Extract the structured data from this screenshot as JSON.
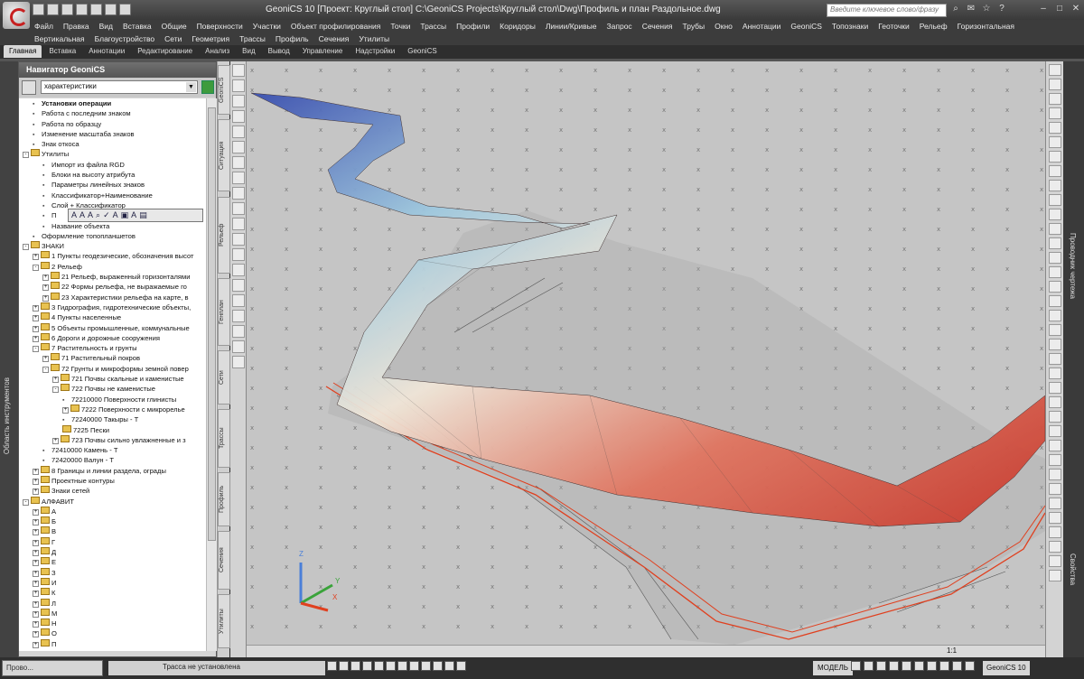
{
  "titlebar": {
    "title": "GeoniCS 10 [Проект: Круглый стол]   C:\\GeoniCS Projects\\Круглый стол\\Dwg\\Профиль и план Раздольное.dwg",
    "search_placeholder": "Введите ключевое слово/фразу"
  },
  "menu": {
    "row1": [
      "Файл",
      "Правка",
      "Вид",
      "Вставка",
      "Общие",
      "Поверхности",
      "Участки",
      "Объект профилирования",
      "Точки",
      "Трассы",
      "Профили",
      "Коридоры",
      "Линии/Кривые",
      "Запрос",
      "Сечения",
      "Трубы",
      "Окно",
      "Аннотации",
      "GeoniCS",
      "Топознаки",
      "Геоточки",
      "Рельеф",
      "Горизонтальная"
    ],
    "row2": [
      "Вертикальная",
      "Благоустройство",
      "Сети",
      "Геометрия",
      "Трассы",
      "Профиль",
      "Сечения",
      "Утилиты"
    ]
  },
  "ribbon_tabs": [
    "Главная",
    "Вставка",
    "Аннотации",
    "Редактирование",
    "Анализ",
    "Вид",
    "Вывод",
    "Управление",
    "Надстройки",
    "GeoniCS"
  ],
  "left_strip_label": "Область инструментов",
  "navigator": {
    "title": "Навигатор GeoniCS",
    "filter_value": "характеристики",
    "rows": [
      {
        "t": "Установки операции",
        "lvl": 1,
        "bold": true
      },
      {
        "t": "Работа с последним знаком",
        "lvl": 1
      },
      {
        "t": "Работа по образцу",
        "lvl": 1
      },
      {
        "t": "Изменение масштаба знаков",
        "lvl": 1
      },
      {
        "t": "Знак откоса",
        "lvl": 1
      },
      {
        "t": "Утилиты",
        "lvl": 0,
        "f": true,
        "pm": "−"
      },
      {
        "t": "Импорт из файла RGD",
        "lvl": 2
      },
      {
        "t": "Блоки на высоту атрибута",
        "lvl": 2
      },
      {
        "t": "Параметры линейных знаков",
        "lvl": 2
      },
      {
        "t": "Классификатор+Наименование",
        "lvl": 2
      },
      {
        "t": "Слой + Классификатор",
        "lvl": 2
      },
      {
        "t": "П",
        "lvl": 2
      },
      {
        "t": "Название объекта",
        "lvl": 2
      },
      {
        "t": "Оформление топопланшетов",
        "lvl": 1
      },
      {
        "t": "ЗНАКИ",
        "lvl": 0,
        "f": true,
        "pm": "−"
      },
      {
        "t": "1 Пункты геодезические, обозначения высот",
        "lvl": 1,
        "f": true,
        "pm": "+"
      },
      {
        "t": "2 Рельеф",
        "lvl": 1,
        "f": true,
        "pm": "−"
      },
      {
        "t": "21 Рельеф, выраженный горизонталями",
        "lvl": 2,
        "f": true,
        "pm": "+"
      },
      {
        "t": "22 Формы рельефа, не выражаемые го",
        "lvl": 2,
        "f": true,
        "pm": "+"
      },
      {
        "t": "23 Характеристики рельефа на карте, в",
        "lvl": 2,
        "f": true,
        "pm": "+"
      },
      {
        "t": "3 Гидрография, гидротехнические объекты,",
        "lvl": 1,
        "f": true,
        "pm": "+"
      },
      {
        "t": "4 Пункты населенные",
        "lvl": 1,
        "f": true,
        "pm": "+"
      },
      {
        "t": "5 Объекты промышленные, коммунальные",
        "lvl": 1,
        "f": true,
        "pm": "+"
      },
      {
        "t": "6 Дороги и дорожные сооружения",
        "lvl": 1,
        "f": true,
        "pm": "+"
      },
      {
        "t": "7 Растительность и грунты",
        "lvl": 1,
        "f": true,
        "pm": "−"
      },
      {
        "t": "71 Растительный покров",
        "lvl": 2,
        "f": true,
        "pm": "+"
      },
      {
        "t": "72 Грунты и микроформы земной повер",
        "lvl": 2,
        "f": true,
        "pm": "−"
      },
      {
        "t": "721 Почвы скальные и каменистые",
        "lvl": 3,
        "f": true,
        "pm": "+"
      },
      {
        "t": "722 Почвы не каменистые",
        "lvl": 3,
        "f": true,
        "pm": "−"
      },
      {
        "t": "72210000 Поверхности глинисты",
        "lvl": 4
      },
      {
        "t": "7222 Поверхности с микрорелье",
        "lvl": 4,
        "f": true,
        "pm": "+"
      },
      {
        "t": "72240000 Такыры - Т",
        "lvl": 4
      },
      {
        "t": "7225 Пески",
        "lvl": 4,
        "f": true
      },
      {
        "t": "723 Почвы сильно увлажненные и з",
        "lvl": 3,
        "f": true,
        "pm": "+"
      },
      {
        "t": "72410000 Камень - Т",
        "lvl": 2
      },
      {
        "t": "72420000 Валун - Т",
        "lvl": 2
      },
      {
        "t": "8 Границы и линии раздела, ограды",
        "lvl": 1,
        "f": true,
        "pm": "+"
      },
      {
        "t": "Проектные контуры",
        "lvl": 1,
        "f": true,
        "pm": "+"
      },
      {
        "t": "Знаки сетей",
        "lvl": 1,
        "f": true,
        "pm": "+"
      },
      {
        "t": "АЛФАВИТ",
        "lvl": 0,
        "f": true,
        "pm": "−"
      },
      {
        "t": "А",
        "lvl": 1,
        "f": true,
        "pm": "+"
      },
      {
        "t": "Б",
        "lvl": 1,
        "f": true,
        "pm": "+"
      },
      {
        "t": "В",
        "lvl": 1,
        "f": true,
        "pm": "+"
      },
      {
        "t": "Г",
        "lvl": 1,
        "f": true,
        "pm": "+"
      },
      {
        "t": "Д",
        "lvl": 1,
        "f": true,
        "pm": "+"
      },
      {
        "t": "Е",
        "lvl": 1,
        "f": true,
        "pm": "+"
      },
      {
        "t": "З",
        "lvl": 1,
        "f": true,
        "pm": "+"
      },
      {
        "t": "И",
        "lvl": 1,
        "f": true,
        "pm": "+"
      },
      {
        "t": "К",
        "lvl": 1,
        "f": true,
        "pm": "+"
      },
      {
        "t": "Л",
        "lvl": 1,
        "f": true,
        "pm": "+"
      },
      {
        "t": "М",
        "lvl": 1,
        "f": true,
        "pm": "+"
      },
      {
        "t": "Н",
        "lvl": 1,
        "f": true,
        "pm": "+"
      },
      {
        "t": "О",
        "lvl": 1,
        "f": true,
        "pm": "+"
      },
      {
        "t": "П",
        "lvl": 1,
        "f": true,
        "pm": "+"
      }
    ]
  },
  "vertical_tabs": [
    "GeoniCS",
    "Ситуация",
    "Рельеф",
    "Генплан",
    "Сети",
    "Трассы",
    "Профиль",
    "Сечения",
    "Утилиты"
  ],
  "right_strip": {
    "top_label": "Проводник чертежа",
    "bottom_label": "Свойства"
  },
  "viewport": {
    "scale_label": "1:1"
  },
  "axes": {
    "z": "Z",
    "y": "Y",
    "x": "X"
  },
  "status": {
    "task_label": "Прово...",
    "command_text": "Трасса не установлена",
    "model_label": "МОДЕЛЬ",
    "workspace": "GeoniCS 10"
  }
}
